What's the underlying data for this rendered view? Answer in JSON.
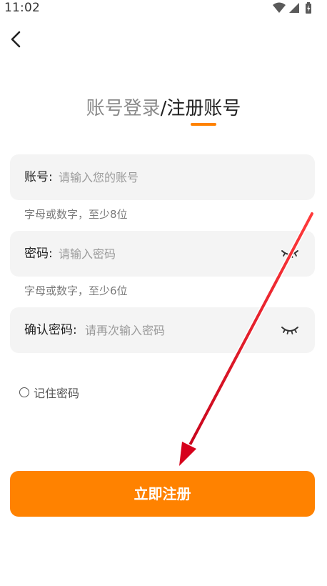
{
  "status_bar": {
    "time": "11:02",
    "icons": [
      "wifi-icon",
      "signal-icon",
      "battery-charging-icon"
    ]
  },
  "header": {
    "back_icon": "chevron-left-icon"
  },
  "title": {
    "login_tab": "账号登录",
    "separator": "/",
    "register_tab": "注册账号",
    "active_tab": "register"
  },
  "form": {
    "account": {
      "label": "账号:",
      "placeholder": "请输入您的账号",
      "value": "",
      "hint": "字母或数字，至少8位"
    },
    "password": {
      "label": "密码:",
      "placeholder": "请输入密码",
      "value": "",
      "hint": "字母或数字，至少6位",
      "toggle_icon": "eye-closed-icon"
    },
    "confirm_password": {
      "label": "确认密码:",
      "placeholder": "请再次输入密码",
      "value": "",
      "toggle_icon": "eye-closed-icon"
    },
    "remember": {
      "label": "记住密码",
      "checked": false
    }
  },
  "actions": {
    "register_label": "立即注册"
  },
  "colors": {
    "accent": "#FF8200",
    "field_bg": "#F4F4F4",
    "annotation_arrow": "#E8001C"
  }
}
